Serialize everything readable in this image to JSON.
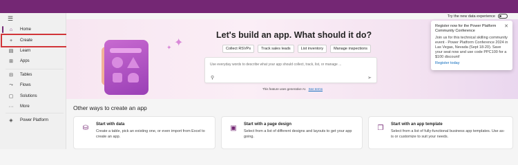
{
  "sidebar": {
    "items": [
      {
        "label": "Home",
        "icon": "home-icon",
        "glyph": "⌂"
      },
      {
        "label": "Create",
        "icon": "plus-icon",
        "glyph": "+"
      },
      {
        "label": "Learn",
        "icon": "book-icon",
        "glyph": "▤"
      },
      {
        "label": "Apps",
        "icon": "apps-icon",
        "glyph": "⊞"
      },
      {
        "label": "Tables",
        "icon": "table-icon",
        "glyph": "⊟"
      },
      {
        "label": "Flows",
        "icon": "flows-icon",
        "glyph": "⤳"
      },
      {
        "label": "Solutions",
        "icon": "solutions-icon",
        "glyph": "▢"
      },
      {
        "label": "More",
        "icon": "more-icon",
        "glyph": "···"
      },
      {
        "label": "Power Platform",
        "icon": "power-platform-icon",
        "glyph": "◈"
      }
    ]
  },
  "header": {
    "toggle_label": "Try the new data experience"
  },
  "hero": {
    "title": "Let's build an app. What should it do?",
    "chips": [
      "Collect RSVPs",
      "Track sales leads",
      "List inventory",
      "Manage inspections"
    ],
    "prompt_placeholder": "Use everyday words to describe what your app should collect, track, list, or manage ...",
    "ai_note": "This feature uses generative AI.",
    "ai_note_link": "See terms"
  },
  "popup": {
    "title": "Register now for the Power Platform Community Conference",
    "body": "Join us for this technical skilling community event - Power Platform Conference 2024 in Las Vegas, Nevada (Sept 18-20). Save your seat now and use code PPC100 for a $100 discount!",
    "link": "Register today"
  },
  "other": {
    "title": "Other ways to create an app",
    "cards": [
      {
        "title": "Start with data",
        "desc": "Create a table, pick an existing one, or even import from Excel to create an app."
      },
      {
        "title": "Start with a page design",
        "desc": "Select from a list of different designs and layouts to get your app going."
      },
      {
        "title": "Start with an app template",
        "desc": "Select from a list of fully-functional business app templates. Use as-is or customize to suit your needs."
      }
    ]
  },
  "colors": {
    "brand": "#742774",
    "highlight": "#d13438",
    "link": "#0f6cbd"
  }
}
